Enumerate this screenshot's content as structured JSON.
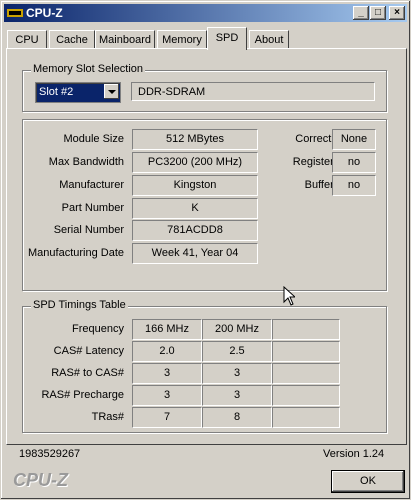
{
  "window": {
    "title": "CPU-Z"
  },
  "tabs": [
    {
      "label": "CPU"
    },
    {
      "label": "Cache"
    },
    {
      "label": "Mainboard"
    },
    {
      "label": "Memory"
    },
    {
      "label": "SPD"
    },
    {
      "label": "About"
    }
  ],
  "memory_slot": {
    "group_label": "Memory Slot Selection",
    "selected_slot": "Slot #2",
    "memory_type": "DDR-SDRAM"
  },
  "module": {
    "size_label": "Module Size",
    "size": "512 MBytes",
    "bandwidth_label": "Max Bandwidth",
    "bandwidth": "PC3200 (200 MHz)",
    "manufacturer_label": "Manufacturer",
    "manufacturer": "Kingston",
    "part_label": "Part Number",
    "part": "K",
    "serial_label": "Serial Number",
    "serial": "781ACDD8",
    "date_label": "Manufacturing Date",
    "date": "Week 41, Year 04",
    "correction_label": "Correction",
    "correction": "None",
    "registered_label": "Registered",
    "registered": "no",
    "buffered_label": "Buffered",
    "buffered": "no"
  },
  "timings": {
    "group_label": "SPD Timings Table",
    "rows": [
      {
        "label": "Frequency",
        "c1": "166 MHz",
        "c2": "200 MHz",
        "c3": ""
      },
      {
        "label": "CAS# Latency",
        "c1": "2.0",
        "c2": "2.5",
        "c3": ""
      },
      {
        "label": "RAS# to CAS#",
        "c1": "3",
        "c2": "3",
        "c3": ""
      },
      {
        "label": "RAS# Precharge",
        "c1": "3",
        "c2": "3",
        "c3": ""
      },
      {
        "label": "TRas#",
        "c1": "7",
        "c2": "8",
        "c3": ""
      }
    ]
  },
  "footer": {
    "serial": "1983529267",
    "version": "Version 1.24",
    "logo": "CPU-Z",
    "ok_label": "OK"
  }
}
